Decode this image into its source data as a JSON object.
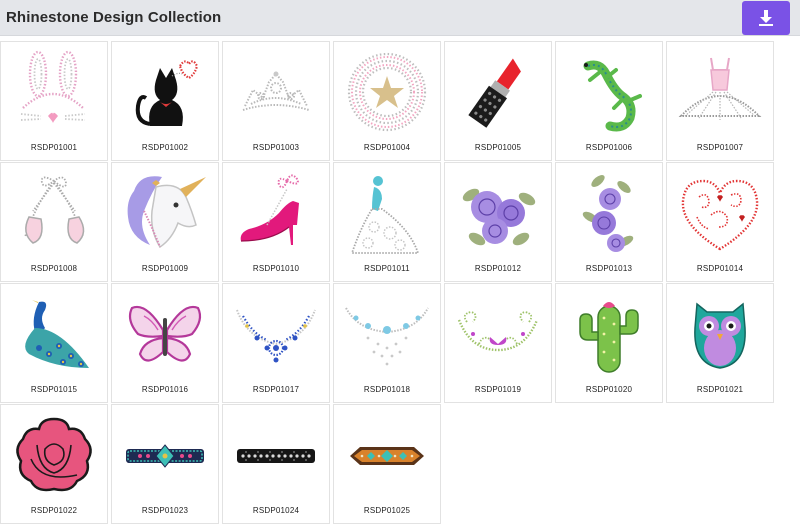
{
  "header": {
    "title": "Rhinestone Design Collection",
    "download_icon": "download-icon",
    "accent": "#7a52e6"
  },
  "designs": [
    {
      "code": "RSDP01001",
      "icon": "bunny-ears-icon"
    },
    {
      "code": "RSDP01002",
      "icon": "cat-with-heart-icon"
    },
    {
      "code": "RSDP01003",
      "icon": "tiara-icon"
    },
    {
      "code": "RSDP01004",
      "icon": "star-burst-icon"
    },
    {
      "code": "RSDP01005",
      "icon": "lipstick-icon"
    },
    {
      "code": "RSDP01006",
      "icon": "gecko-icon"
    },
    {
      "code": "RSDP01007",
      "icon": "tutu-dress-icon"
    },
    {
      "code": "RSDP01008",
      "icon": "ballet-shoes-icon"
    },
    {
      "code": "RSDP01009",
      "icon": "unicorn-head-icon"
    },
    {
      "code": "RSDP01010",
      "icon": "high-heel-shoe-icon"
    },
    {
      "code": "RSDP01011",
      "icon": "gown-lady-icon"
    },
    {
      "code": "RSDP01012",
      "icon": "rose-flowers-icon"
    },
    {
      "code": "RSDP01013",
      "icon": "flower-cluster-icon"
    },
    {
      "code": "RSDP01014",
      "icon": "swirl-heart-icon"
    },
    {
      "code": "RSDP01015",
      "icon": "peacock-icon"
    },
    {
      "code": "RSDP01016",
      "icon": "butterfly-icon"
    },
    {
      "code": "RSDP01017",
      "icon": "blue-necklace-icon"
    },
    {
      "code": "RSDP01018",
      "icon": "crystal-necklace-icon"
    },
    {
      "code": "RSDP01019",
      "icon": "floral-swag-icon"
    },
    {
      "code": "RSDP01020",
      "icon": "cactus-icon"
    },
    {
      "code": "RSDP01021",
      "icon": "owl-icon"
    },
    {
      "code": "RSDP01022",
      "icon": "pink-rose-icon"
    },
    {
      "code": "RSDP01023",
      "icon": "teal-band-icon"
    },
    {
      "code": "RSDP01024",
      "icon": "black-band-icon"
    },
    {
      "code": "RSDP01025",
      "icon": "aztec-band-icon"
    }
  ]
}
